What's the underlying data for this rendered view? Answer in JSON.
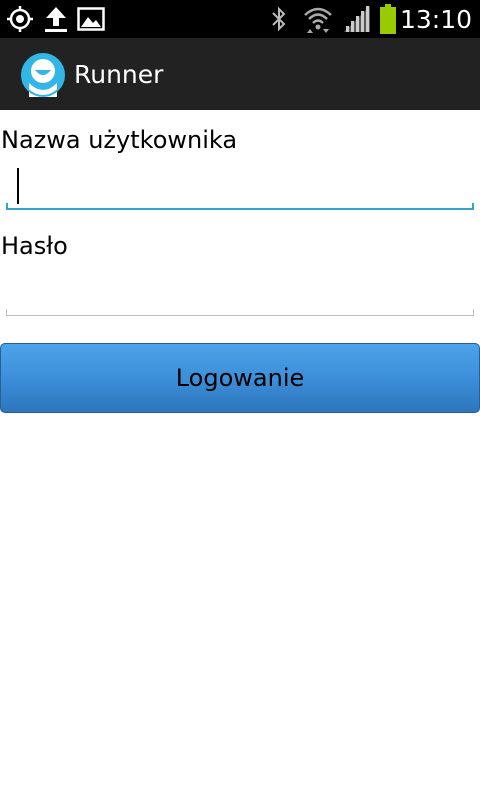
{
  "status_bar": {
    "time": "13:10",
    "left_icons": [
      "gps-icon",
      "upload-icon",
      "image-icon"
    ],
    "right_icons": [
      "bluetooth-icon",
      "wifi-icon",
      "signal-icon",
      "battery-icon"
    ]
  },
  "action_bar": {
    "title": "Runner",
    "icon": "app-logo-icon"
  },
  "form": {
    "username_label": "Nazwa użytkownika",
    "username_value": "",
    "password_label": "Hasło",
    "password_value": "",
    "login_button": "Logowanie"
  },
  "colors": {
    "focus_underline": "#33a5c8",
    "idle_underline": "#bdbdbd",
    "button_top": "#4ea3ea",
    "button_bottom": "#2d76bd",
    "battery": "#99cc00"
  }
}
